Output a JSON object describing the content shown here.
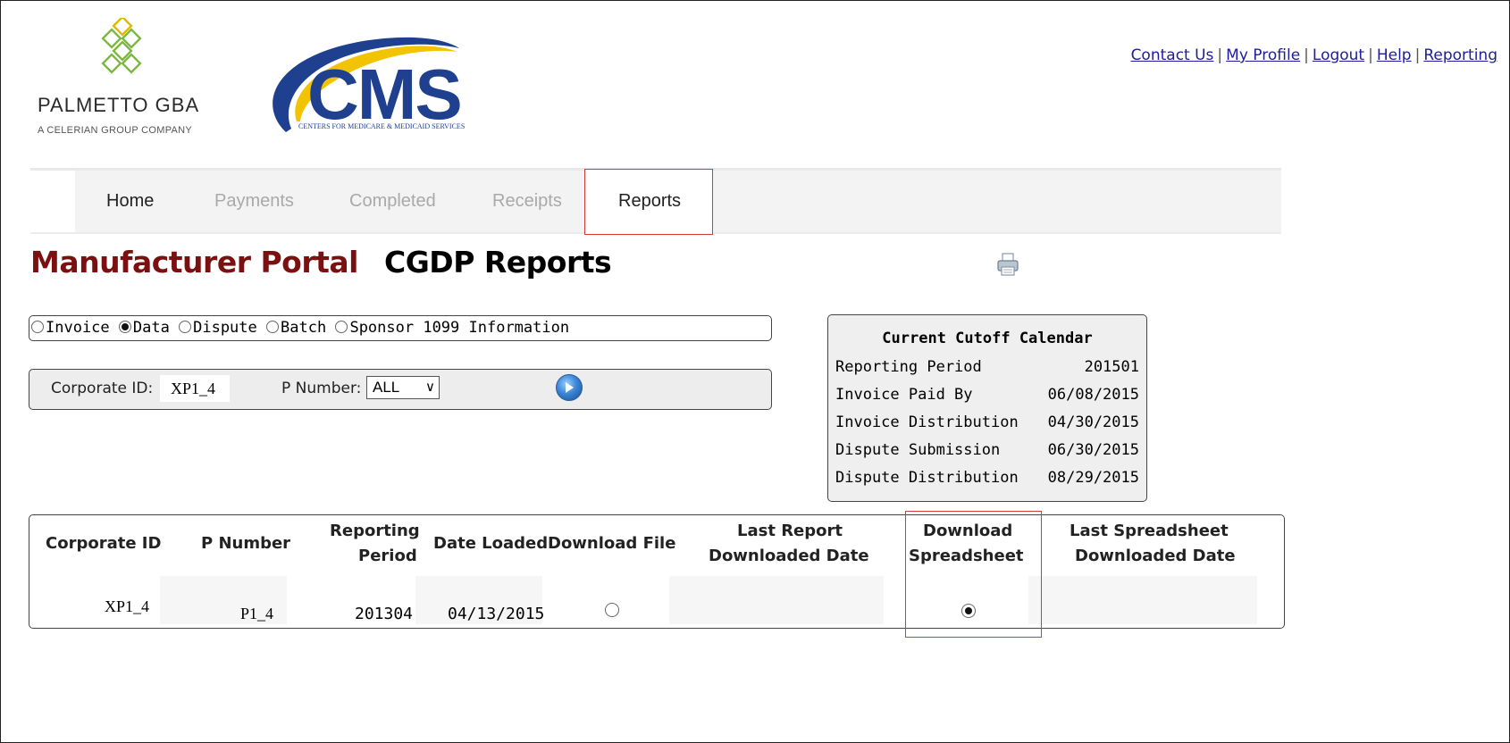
{
  "header": {
    "logo_palmetto": {
      "name": "PALMETTO GBA",
      "tagline": "A CELERIAN GROUP COMPANY"
    },
    "logo_cms": {
      "letters": "CMS",
      "tagline": "CENTERS FOR MEDICARE & MEDICAID SERVICES"
    },
    "top_links": [
      "Contact Us",
      "My Profile",
      "Logout",
      "Help",
      "Reporting"
    ]
  },
  "nav": {
    "tabs": [
      {
        "label": "Home",
        "state": "enabled"
      },
      {
        "label": "Payments",
        "state": "disabled"
      },
      {
        "label": "Completed",
        "state": "disabled"
      },
      {
        "label": "Receipts",
        "state": "disabled"
      },
      {
        "label": "Reports",
        "state": "active"
      }
    ]
  },
  "page": {
    "portal_title": "Manufacturer Portal",
    "report_title": "CGDP Reports",
    "print_icon": "printer-icon"
  },
  "report_type": {
    "options": [
      "Invoice",
      "Data",
      "Dispute",
      "Batch",
      "Sponsor 1099 Information"
    ],
    "selected": "Data"
  },
  "filter": {
    "corporate_id_label": "Corporate ID:",
    "corporate_id_value": "XP1_4",
    "p_number_label": "P Number:",
    "p_number_value": "ALL",
    "go_icon": "go-arrow-icon"
  },
  "calendar": {
    "title": "Current Cutoff Calendar",
    "rows": [
      {
        "label": "Reporting Period",
        "value": "201501"
      },
      {
        "label": "Invoice Paid By",
        "value": "06/08/2015"
      },
      {
        "label": "Invoice Distribution",
        "value": "04/30/2015"
      },
      {
        "label": "Dispute Submission",
        "value": "06/30/2015"
      },
      {
        "label": "Dispute Distribution",
        "value": "08/29/2015"
      }
    ]
  },
  "results": {
    "headers": {
      "corporate_id": "Corporate ID",
      "p_number": "P Number",
      "reporting_period_1": "Reporting",
      "reporting_period_2": "Period",
      "date_loaded": "Date Loaded",
      "download_file": "Download File",
      "last_report_1": "Last Report",
      "last_report_2": "Downloaded Date",
      "download_sheet_1": "Download",
      "download_sheet_2": "Spreadsheet",
      "last_sheet_1": "Last Spreadsheet",
      "last_sheet_2": "Downloaded Date"
    },
    "rows": [
      {
        "corporate_id": "XP1_4",
        "p_number": "P1_4",
        "reporting_period": "201304",
        "date_loaded": "04/13/2015",
        "download_file_selected": false,
        "last_report_downloaded": "",
        "download_spreadsheet_selected": true,
        "last_spreadsheet_downloaded": ""
      }
    ]
  },
  "colors": {
    "portal_title": "#7a1010",
    "highlight_box": "#d83a3a",
    "link": "#1d1d9b",
    "cms_blue": "#1f3f8f",
    "cms_swoosh": "#f2c300"
  }
}
